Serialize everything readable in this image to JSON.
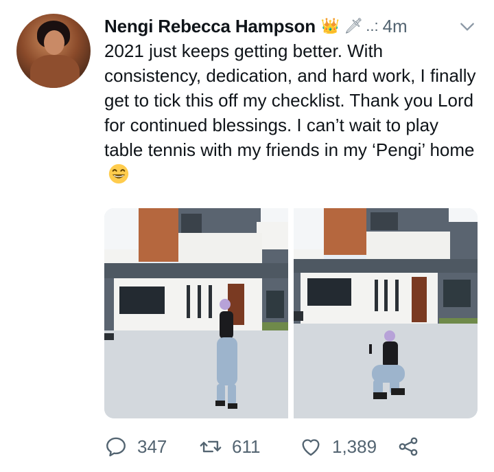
{
  "author": {
    "name": "Nengi Rebecca Hampson",
    "badges": [
      "👑",
      "🗡"
    ],
    "separator": "..:",
    "time": "4m"
  },
  "tweet": {
    "text": "2021 just keeps getting better. With consistency, dedication, and hard work, I finally get to tick this off my checklist. Thank you Lord for continued blessings. I can’t wait to play table tennis with my friends in my ‘Pengi’ home"
  },
  "icons": {
    "more": "chevron-down-icon",
    "reply": "reply-icon",
    "retweet": "retweet-icon",
    "like": "heart-icon",
    "share": "share-icon",
    "emoji": "grinning-face-emoji"
  },
  "media": [
    {
      "subject": "woman standing in front of house"
    },
    {
      "subject": "woman crouching in front of house"
    }
  ],
  "stats": {
    "replies": "347",
    "retweets": "611",
    "likes": "1,389"
  },
  "colors": {
    "text": "#0f1419",
    "secondary": "#536471",
    "building_gray": "#5a6470",
    "building_white": "#f3f3f1",
    "wood": "#b5673e"
  }
}
